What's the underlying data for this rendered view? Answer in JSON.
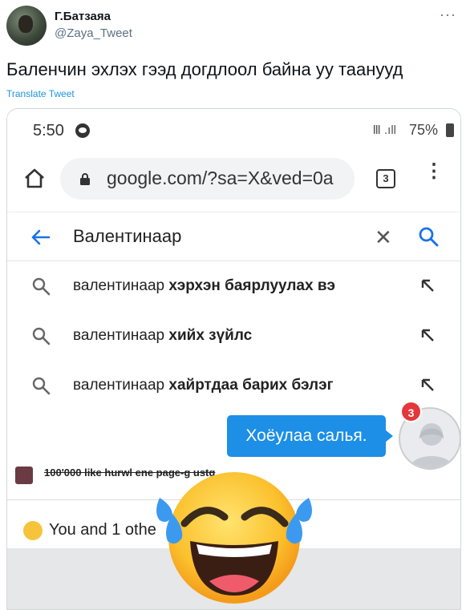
{
  "tweet": {
    "display_name": "Г.Батзаяа",
    "handle": "@Zaya_Tweet",
    "more": "···",
    "text": "Баленчин эхлэх гээд догдлоол байна уу таанууд",
    "translate_label": "Translate Tweet"
  },
  "phone": {
    "status": {
      "time": "5:50",
      "signal": "Ⅲ .ıll",
      "battery": "75%"
    },
    "browser": {
      "url": "google.com/?sa=X&ved=0a",
      "tab_count": "3",
      "menu": "⋮"
    },
    "search": {
      "query": "Валентинаар",
      "clear": "✕",
      "suggestions": [
        {
          "prefix": "валентинаар ",
          "bold": "хэрхэн баярлуулах вэ"
        },
        {
          "prefix": "валентинаар ",
          "bold": "хийх зүйлс"
        },
        {
          "prefix": "валентинаар ",
          "bold": "хайртдаа барих бэлэг"
        }
      ]
    },
    "chat": {
      "message": "Хоёулаа салья.",
      "badge": "3"
    },
    "feed": {
      "post_text": "100'000 like hurwl ene page-g ustg",
      "reaction_text": "You and 1 othe"
    }
  },
  "colors": {
    "accent_blue": "#1a73e8",
    "chat_blue": "#1d8fe6",
    "badge_red": "#e4373c",
    "link_blue": "#1b95e0"
  }
}
